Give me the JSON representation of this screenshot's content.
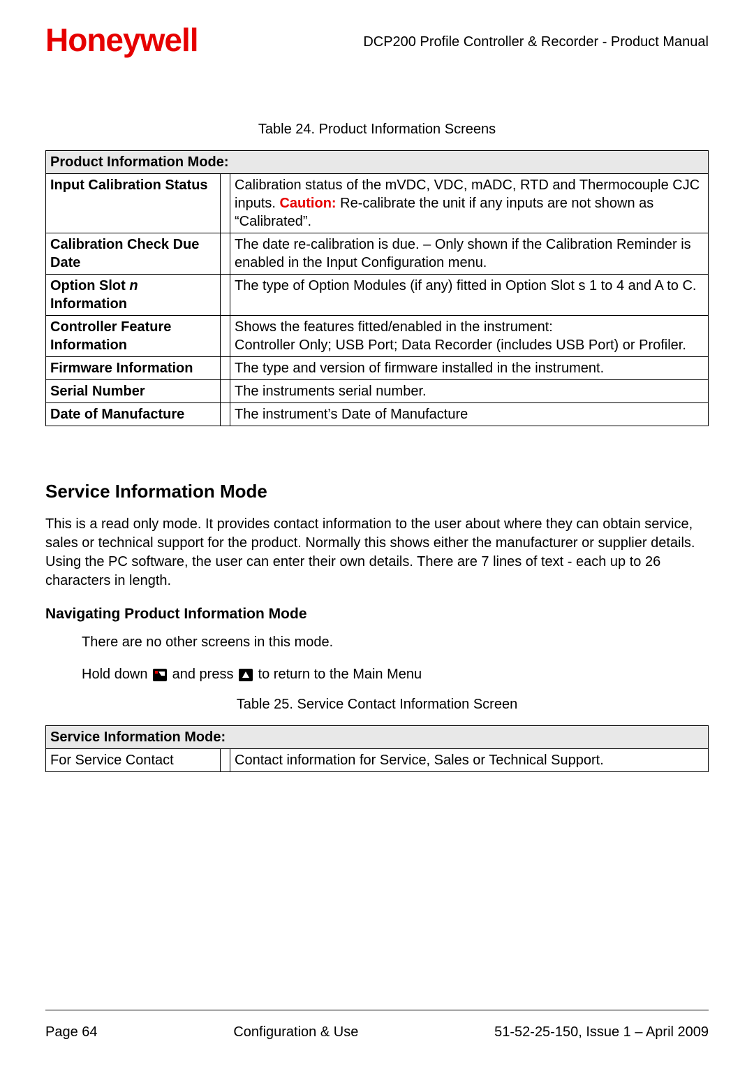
{
  "header": {
    "logo": "Honeywell",
    "title": "DCP200 Profile Controller & Recorder - Product Manual"
  },
  "table24": {
    "caption": "Table 24. Product Information Screens",
    "header": "Product Information Mode:",
    "rows": [
      {
        "label": "Input Calibration Status",
        "desc_pre": "Calibration status of the mVDC, VDC, mADC, RTD and Thermocouple CJC inputs. ",
        "caution": "Caution:",
        "desc_post": " Re-calibrate the unit if any inputs are not shown as “Calibrated”."
      },
      {
        "label": "Calibration Check Due Date",
        "desc": "The date re-calibration is due. – Only shown if the Calibration Reminder is enabled in the Input Configuration menu."
      },
      {
        "label_pre": "Option Slot ",
        "label_italic": "n",
        "label_post": " Information",
        "desc": "The type of Option Modules (if any) fitted in Option Slot s 1 to 4 and A to C."
      },
      {
        "label": "Controller Feature Information",
        "desc": "Shows the features fitted/enabled in the instrument:\nController Only; USB Port; Data Recorder (includes USB Port) or Profiler."
      },
      {
        "label": "Firmware Information",
        "desc": "The type and version of firmware installed in the instrument."
      },
      {
        "label": "Serial Number",
        "desc": "The instruments serial number."
      },
      {
        "label": "Date of Manufacture",
        "desc": "The instrument’s Date of Manufacture"
      }
    ]
  },
  "section": {
    "heading": "Service Information Mode",
    "paragraph": "This is a read only mode. It provides contact information to the user about where they can obtain service, sales or technical support for the product. Normally this shows either the manufacturer or supplier details. Using the PC software, the user can enter their own details. There are 7 lines of text - each up to 26 characters in length.",
    "subheading": "Navigating Product Information Mode",
    "nav1": "There are no other screens in this mode.",
    "nav2_pre": "Hold down ",
    "nav2_mid": " and press ",
    "nav2_post": " to return to the Main Menu"
  },
  "table25": {
    "caption": "Table 25. Service Contact Information Screen",
    "header": "Service Information Mode:",
    "row_label": "For Service Contact",
    "row_desc": "Contact information for Service, Sales or Technical Support."
  },
  "footer": {
    "left": "Page 64",
    "center": "Configuration & Use",
    "right": "51-52-25-150, Issue 1 – April 2009"
  }
}
